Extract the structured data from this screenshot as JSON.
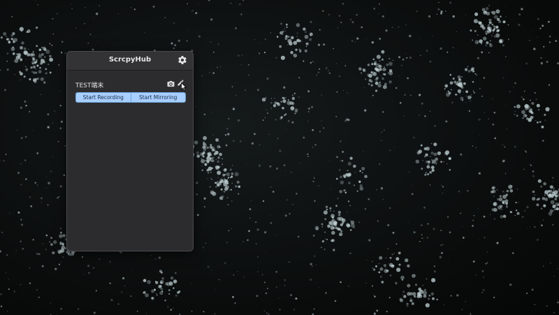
{
  "app": {
    "title": "ScrcpyHub"
  },
  "toolbar": {
    "settings_icon": "gear-icon"
  },
  "devices": [
    {
      "name": "TEST端末",
      "screenshot_icon": "camera-icon",
      "edit_icon": "pencil-icon",
      "record_label": "Start Recording",
      "mirror_label": "Start Mirroring"
    }
  ],
  "colors": {
    "panel_bg": "#2c2c2e",
    "button_bg": "#a7ceff",
    "button_border": "#6fa5de",
    "desktop_bg": "#0b0d0d"
  }
}
